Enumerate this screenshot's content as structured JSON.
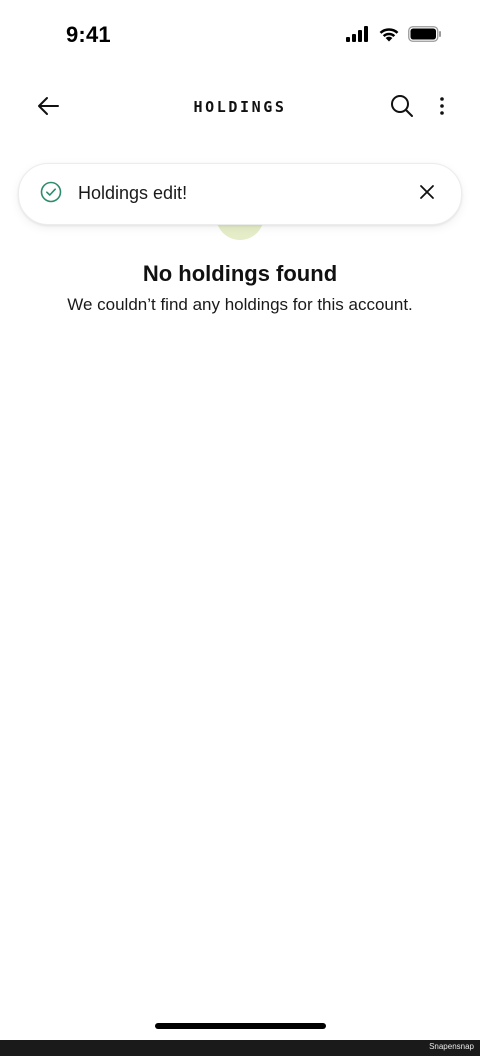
{
  "status_bar": {
    "time": "9:41",
    "icons": [
      "signal-icon",
      "wifi-icon",
      "battery-icon"
    ]
  },
  "header": {
    "title": "HOLDINGS",
    "back_icon": "arrow-left-icon",
    "search_icon": "search-icon",
    "more_icon": "more-vertical-icon"
  },
  "toast": {
    "message": "Holdings edit!",
    "icon": "check-circle-icon",
    "close_icon": "close-icon",
    "accent_color": "#2e8b6e"
  },
  "empty_state": {
    "title": "No holdings found",
    "subtitle": "We couldn’t find any holdings for this account.",
    "illustration_color": "#e4edc8"
  },
  "footer": {
    "watermark": "Snapensnap"
  }
}
